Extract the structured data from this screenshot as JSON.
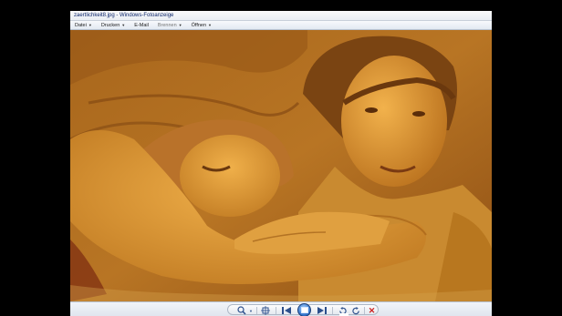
{
  "window": {
    "title": "zaertlichkeit8.jpg - Windows-Fotoanzeige"
  },
  "menu": {
    "items": [
      {
        "label": "Datei",
        "has_dropdown": true
      },
      {
        "label": "Drucken",
        "has_dropdown": true
      },
      {
        "label": "E-Mail",
        "has_dropdown": false
      },
      {
        "label": "Brennen",
        "has_dropdown": true
      },
      {
        "label": "Öffnen",
        "has_dropdown": true
      }
    ]
  },
  "controls": {
    "icons": [
      "zoom-icon",
      "fit-to-window-icon",
      "previous-icon",
      "slideshow-icon",
      "next-icon",
      "rotate-left-icon",
      "rotate-right-icon",
      "delete-icon"
    ]
  },
  "colors": {
    "photo_tone": "#c7892a",
    "accent": "#2e6fc7",
    "delete": "#cc2222"
  }
}
